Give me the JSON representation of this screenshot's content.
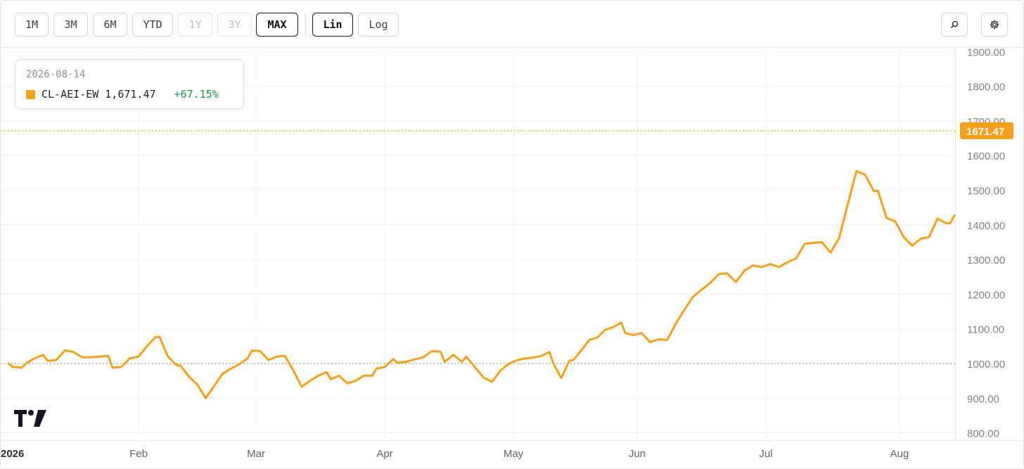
{
  "toolbar": {
    "ranges": [
      {
        "label": "1M",
        "state": "normal"
      },
      {
        "label": "3M",
        "state": "normal"
      },
      {
        "label": "6M",
        "state": "normal"
      },
      {
        "label": "YTD",
        "state": "normal"
      },
      {
        "label": "1Y",
        "state": "disabled"
      },
      {
        "label": "3Y",
        "state": "disabled"
      },
      {
        "label": "MAX",
        "state": "active"
      }
    ],
    "scales": [
      {
        "label": "Lin",
        "state": "active"
      },
      {
        "label": "Log",
        "state": "normal"
      }
    ],
    "icons": [
      "search-icon",
      "gear-icon"
    ]
  },
  "legend": {
    "date": "2026-08-14",
    "series": "CL-AEI-EW",
    "value": "1,671.47",
    "change": "+67.15%"
  },
  "colors": {
    "line": "#f7a11a",
    "positive": "#1b9a3c",
    "baseline": "#9aa0a8",
    "grid": "#eef0f3"
  },
  "chart_data": {
    "type": "line",
    "series": [
      {
        "name": "CL-AEI-EW",
        "points": [
          [
            "2026-01-02",
            1000
          ],
          [
            "2026-01-03",
            990
          ],
          [
            "2026-01-05",
            988
          ],
          [
            "2026-01-06",
            1000
          ],
          [
            "2026-01-08",
            1015
          ],
          [
            "2026-01-10",
            1025
          ],
          [
            "2026-01-11",
            1008
          ],
          [
            "2026-01-13",
            1010
          ],
          [
            "2026-01-15",
            1038
          ],
          [
            "2026-01-17",
            1033
          ],
          [
            "2026-01-19",
            1018
          ],
          [
            "2026-01-21",
            1018
          ],
          [
            "2026-01-23",
            1020
          ],
          [
            "2026-01-25",
            1022
          ],
          [
            "2026-01-26",
            988
          ],
          [
            "2026-01-28",
            990
          ],
          [
            "2026-01-30",
            1015
          ],
          [
            "2026-02-01",
            1020
          ],
          [
            "2026-02-03",
            1050
          ],
          [
            "2026-02-05",
            1076
          ],
          [
            "2026-02-06",
            1077
          ],
          [
            "2026-02-08",
            1020
          ],
          [
            "2026-02-10",
            996
          ],
          [
            "2026-02-11",
            994
          ],
          [
            "2026-02-13",
            962
          ],
          [
            "2026-02-15",
            940
          ],
          [
            "2026-02-17",
            900
          ],
          [
            "2026-02-19",
            935
          ],
          [
            "2026-02-21",
            970
          ],
          [
            "2026-02-23",
            985
          ],
          [
            "2026-02-25",
            998
          ],
          [
            "2026-02-27",
            1015
          ],
          [
            "2026-02-28",
            1037
          ],
          [
            "2026-03-02",
            1036
          ],
          [
            "2026-03-04",
            1010
          ],
          [
            "2026-03-06",
            1020
          ],
          [
            "2026-03-08",
            1022
          ],
          [
            "2026-03-10",
            980
          ],
          [
            "2026-03-12",
            933
          ],
          [
            "2026-03-14",
            950
          ],
          [
            "2026-03-16",
            965
          ],
          [
            "2026-03-18",
            975
          ],
          [
            "2026-03-19",
            955
          ],
          [
            "2026-03-21",
            965
          ],
          [
            "2026-03-23",
            943
          ],
          [
            "2026-03-25",
            950
          ],
          [
            "2026-03-27",
            965
          ],
          [
            "2026-03-29",
            965
          ],
          [
            "2026-03-30",
            985
          ],
          [
            "2026-04-01",
            990
          ],
          [
            "2026-04-03",
            1013
          ],
          [
            "2026-04-04",
            1002
          ],
          [
            "2026-04-06",
            1005
          ],
          [
            "2026-04-08",
            1012
          ],
          [
            "2026-04-10",
            1018
          ],
          [
            "2026-04-12",
            1036
          ],
          [
            "2026-04-14",
            1034
          ],
          [
            "2026-04-15",
            1005
          ],
          [
            "2026-04-17",
            1025
          ],
          [
            "2026-04-19",
            1005
          ],
          [
            "2026-04-20",
            1020
          ],
          [
            "2026-04-22",
            990
          ],
          [
            "2026-04-24",
            960
          ],
          [
            "2026-04-26",
            947
          ],
          [
            "2026-04-28",
            980
          ],
          [
            "2026-04-30",
            1000
          ],
          [
            "2026-05-02",
            1010
          ],
          [
            "2026-05-04",
            1015
          ],
          [
            "2026-05-06",
            1017
          ],
          [
            "2026-05-08",
            1022
          ],
          [
            "2026-05-10",
            1033
          ],
          [
            "2026-05-11",
            1000
          ],
          [
            "2026-05-13",
            958
          ],
          [
            "2026-05-15",
            1008
          ],
          [
            "2026-05-16",
            1010
          ],
          [
            "2026-05-18",
            1038
          ],
          [
            "2026-05-20",
            1068
          ],
          [
            "2026-05-22",
            1075
          ],
          [
            "2026-05-24",
            1097
          ],
          [
            "2026-05-26",
            1105
          ],
          [
            "2026-05-28",
            1118
          ],
          [
            "2026-05-29",
            1088
          ],
          [
            "2026-05-31",
            1082
          ],
          [
            "2026-06-02",
            1088
          ],
          [
            "2026-06-04",
            1062
          ],
          [
            "2026-06-06",
            1070
          ],
          [
            "2026-06-08",
            1068
          ],
          [
            "2026-06-10",
            1115
          ],
          [
            "2026-06-12",
            1155
          ],
          [
            "2026-06-14",
            1192
          ],
          [
            "2026-06-16",
            1213
          ],
          [
            "2026-06-18",
            1232
          ],
          [
            "2026-06-20",
            1258
          ],
          [
            "2026-06-22",
            1260
          ],
          [
            "2026-06-24",
            1235
          ],
          [
            "2026-06-26",
            1268
          ],
          [
            "2026-06-28",
            1283
          ],
          [
            "2026-06-30",
            1278
          ],
          [
            "2026-07-02",
            1287
          ],
          [
            "2026-07-04",
            1278
          ],
          [
            "2026-07-06",
            1292
          ],
          [
            "2026-07-08",
            1303
          ],
          [
            "2026-07-10",
            1345
          ],
          [
            "2026-07-12",
            1348
          ],
          [
            "2026-07-14",
            1350
          ],
          [
            "2026-07-16",
            1320
          ],
          [
            "2026-07-18",
            1362
          ],
          [
            "2026-07-20",
            1460
          ],
          [
            "2026-07-22",
            1555
          ],
          [
            "2026-07-24",
            1545
          ],
          [
            "2026-07-26",
            1498
          ],
          [
            "2026-07-27",
            1498
          ],
          [
            "2026-07-29",
            1420
          ],
          [
            "2026-07-31",
            1410
          ],
          [
            "2026-08-02",
            1365
          ],
          [
            "2026-08-04",
            1340
          ],
          [
            "2026-08-06",
            1360
          ],
          [
            "2026-08-08",
            1365
          ],
          [
            "2026-08-10",
            1418
          ],
          [
            "2026-08-12",
            1405
          ],
          [
            "2026-08-13",
            1405
          ],
          [
            "2026-08-14",
            1427
          ]
        ]
      }
    ],
    "note_x_axis": "x positions mapped by index across months Jan..Aug 2026",
    "x_tick_labels": [
      "2026",
      "Feb",
      "Mar",
      "Apr",
      "May",
      "Jun",
      "Jul",
      "Aug"
    ],
    "y_ticks": [
      800,
      900,
      1000,
      1100,
      1200,
      1300,
      1400,
      1500,
      1600,
      1700,
      1800,
      1900
    ],
    "y_tick_labels": [
      "800.00",
      "900.00",
      "1000.00",
      "1100.00",
      "1200.00",
      "1300.00",
      "1400.00",
      "1500.00",
      "1600.00",
      "1700.00",
      "1800.00",
      "1900.00"
    ],
    "ylim": [
      780,
      1920
    ],
    "baseline": 1000,
    "last_value": 1671.47,
    "last_value_label": "1671.47",
    "grid": true,
    "scale": "linear"
  }
}
